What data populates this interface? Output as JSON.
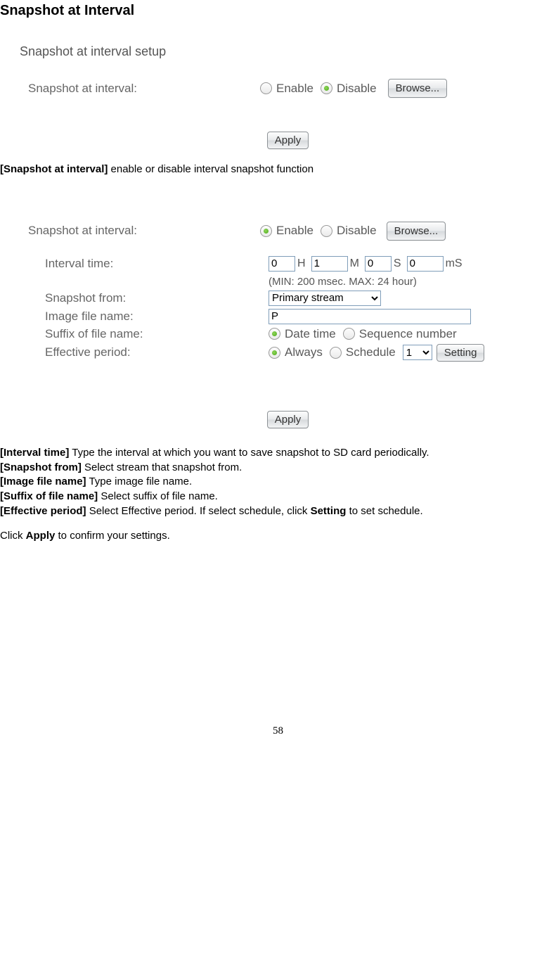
{
  "title": "Snapshot at Interval",
  "panel1": {
    "heading": "Snapshot at interval setup",
    "label": "Snapshot at interval:",
    "enable": "Enable",
    "disable": "Disable",
    "browse": "Browse...",
    "apply": "Apply"
  },
  "desc1": {
    "key": "[Snapshot at interval]",
    "text": " enable or disable interval snapshot function"
  },
  "panel2": {
    "label_main": "Snapshot at interval:",
    "enable": "Enable",
    "disable": "Disable",
    "browse": "Browse...",
    "interval_label": "Interval time:",
    "h_val": "0",
    "h_unit": "H",
    "m_val": "1",
    "m_unit": "M",
    "s_val": "0",
    "s_unit": "S",
    "ms_val": "0",
    "ms_unit": "mS",
    "hint": "(MIN: 200 msec. MAX: 24 hour)",
    "from_label": "Snapshot from:",
    "from_value": "Primary stream",
    "imgname_label": "Image file name:",
    "imgname_value": "P",
    "suffix_label": "Suffix of file name:",
    "suffix_datetime": "Date time",
    "suffix_seq": "Sequence number",
    "eff_label": "Effective period:",
    "eff_always": "Always",
    "eff_schedule": "Schedule",
    "eff_schedule_val": "1",
    "setting": "Setting",
    "apply": "Apply"
  },
  "desc2": {
    "l1k": "[Interval time]",
    "l1t": " Type the interval at which you want to save snapshot to SD card periodically.",
    "l2k": "[Snapshot from]",
    "l2t": " Select stream that snapshot from.",
    "l3k": "[Image file name]",
    "l3t": " Type image file name.",
    "l4k": "[Suffix of file name]",
    "l4t": " Select suffix of file name.",
    "l5k": "[Effective period]",
    "l5t": " Select Effective period. If select schedule, click ",
    "l5s": "Setting",
    "l5t2": " to set schedule.",
    "final1": "Click ",
    "final_b": "Apply",
    "final2": " to confirm your settings."
  },
  "page_number": "58"
}
